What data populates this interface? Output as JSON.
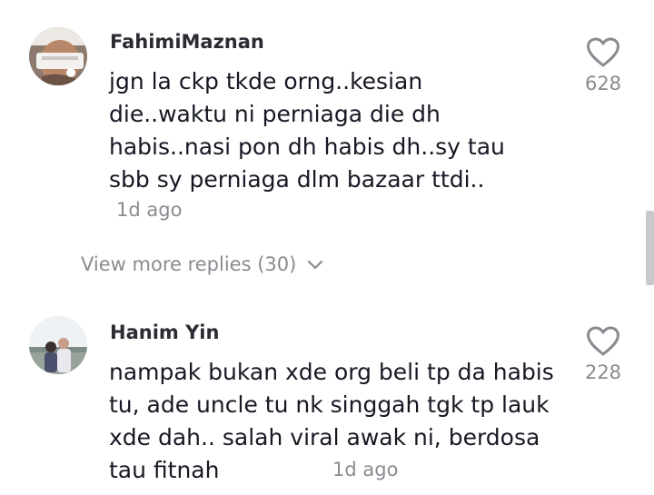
{
  "comments": [
    {
      "username": "FahimiMaznan",
      "text": "jgn la ckp tkde orng..kesian die..waktu ni perniaga die dh habis..nasi pon dh habis dh..sy tau sbb sy perniaga dlm bazaar ttdi..",
      "time": "1d ago",
      "likes": "628"
    },
    {
      "username": "Hanim Yin",
      "text": "nampak bukan xde org beli tp da habis tu, ade uncle tu nk singgah tgk tp lauk xde dah.. salah viral awak ni, berdosa tau fitnah",
      "time": "1d ago",
      "likes": "228"
    }
  ],
  "view_more": {
    "label": "View more replies (30)"
  },
  "icons": {
    "like": "heart-icon",
    "expand": "chevron-down-icon"
  },
  "colors": {
    "text": "#161823",
    "secondary": "#8a8b91",
    "username": "#2b2b33"
  }
}
